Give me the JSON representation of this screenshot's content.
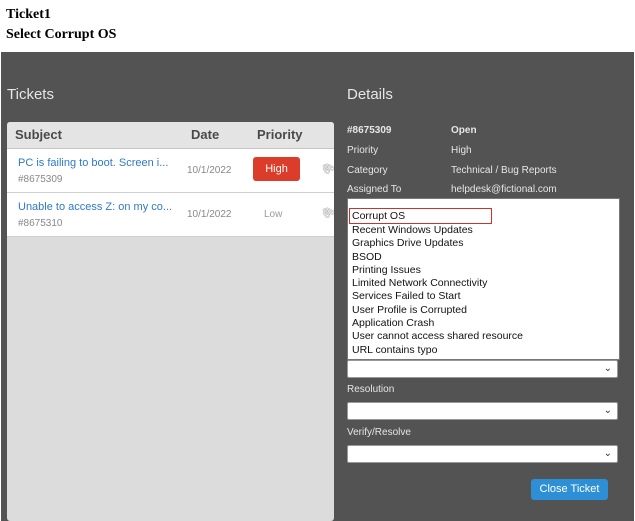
{
  "instructions": {
    "line1": "Ticket1",
    "line2": "Select Corrupt OS"
  },
  "tickets_panel": {
    "title": "Tickets",
    "columns": {
      "subject": "Subject",
      "date": "Date",
      "priority": "Priority"
    },
    "rows": [
      {
        "subject": "PC is failing to boot. Screen i...",
        "number": "#8675309",
        "date": "10/1/2022",
        "priority": "High"
      },
      {
        "subject": "Unable to access Z: on my co...",
        "number": "#8675310",
        "date": "10/1/2022",
        "priority": "Low"
      }
    ]
  },
  "details": {
    "title": "Details",
    "ticket_number": "#8675309",
    "status": "Open",
    "priority_label": "Priority",
    "priority_value": "High",
    "category_label": "Category",
    "category_value": "Technical / Bug Reports",
    "assigned_label": "Assigned To",
    "assigned_value": "helpdesk@fictional.com",
    "issue_options": [
      "Corrupt OS",
      "Recent Windows Updates",
      "Graphics Drive Updates",
      "BSOD",
      "Printing Issues",
      "Limited Network Connectivity",
      "Services Failed to Start",
      "User Profile is Corrupted",
      "Application Crash",
      "User cannot access shared resource",
      "URL contains typo"
    ],
    "resolution_label": "Resolution",
    "verify_label": "Verify/Resolve",
    "close_button": "Close Ticket"
  },
  "colors": {
    "app_background": "#535353",
    "high_priority": "#dc3c2a",
    "link": "#2f79c7",
    "primary_button": "#2d8fd6",
    "highlight_box": "#c8352c"
  }
}
